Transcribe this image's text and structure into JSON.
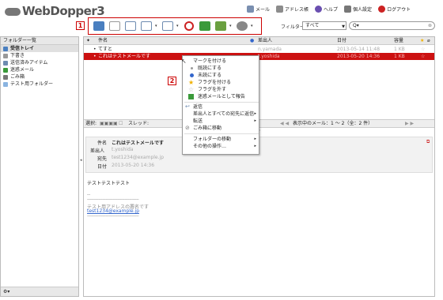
{
  "app": {
    "logo": "WebDopper3"
  },
  "topnav": [
    {
      "label": "メール",
      "icon": "mail-icon",
      "color": "#7a8fb0"
    },
    {
      "label": "アドレス帳",
      "icon": "address-book-icon",
      "color": "#8c8c8c"
    },
    {
      "label": "ヘルプ",
      "icon": "help-icon",
      "color": "#6a4fb0"
    },
    {
      "label": "個人設定",
      "icon": "personal-settings-icon",
      "color": "#777777"
    },
    {
      "label": "ログアウト",
      "icon": "logout-icon",
      "color": "#cc2222"
    }
  ],
  "callouts": {
    "toolbar": "1",
    "menu": "2"
  },
  "toolbar": {
    "buttons": [
      {
        "name": "check-mail-button",
        "icon": "check-mail-icon",
        "color": "#4a7fc0",
        "caret": false
      },
      {
        "name": "compose-button",
        "icon": "compose-icon",
        "color": "#9a9a9a",
        "caret": false
      },
      {
        "name": "reply-button",
        "icon": "reply-icon",
        "color": "#6d8bb0",
        "caret": false
      },
      {
        "name": "reply-all-button",
        "icon": "reply-all-icon",
        "color": "#6d8bb0",
        "caret": true
      },
      {
        "name": "forward-button",
        "icon": "forward-icon",
        "color": "#6d8bb0",
        "caret": true
      },
      {
        "name": "delete-button",
        "icon": "delete-icon",
        "color": "#cc2222",
        "caret": false
      },
      {
        "name": "print-button",
        "icon": "print-icon",
        "color": "#3a9a3a",
        "caret": false
      },
      {
        "name": "mark-button",
        "icon": "mark-icon",
        "color": "#6aa040",
        "caret": true
      },
      {
        "name": "more-button",
        "icon": "gear-icon",
        "color": "#888888",
        "caret": true
      }
    ]
  },
  "filter": {
    "label": "フィルター:",
    "value": "すべて",
    "search_placeholder": "Q▾"
  },
  "sidebar": {
    "title": "フォルダー一覧",
    "items": [
      {
        "label": "受信トレイ",
        "icon": "inbox-icon",
        "color": "#4a7fc0",
        "selected": true
      },
      {
        "label": "下書き",
        "icon": "drafts-icon",
        "color": "#999999",
        "selected": false
      },
      {
        "label": "送信済みアイテム",
        "icon": "sent-icon",
        "color": "#6d8bb0",
        "selected": false
      },
      {
        "label": "迷惑メール",
        "icon": "junk-icon",
        "color": "#3a9a3a",
        "selected": false
      },
      {
        "label": "ごみ箱",
        "icon": "trash-icon",
        "color": "#777777",
        "selected": false
      },
      {
        "label": "テスト用フォルダー",
        "icon": "folder-icon",
        "color": "#8ab4e0",
        "selected": false
      }
    ],
    "footer": "⚙▾"
  },
  "list": {
    "headers": {
      "subject": "件名",
      "from": "差出人",
      "date": "日付",
      "size": "容量"
    },
    "rows": [
      {
        "subject": "てすと",
        "from": "n.yamada",
        "date": "2013-05-14 11:48",
        "size": "1 KB",
        "selected": false
      },
      {
        "subject": "これはテストメールです",
        "from": "t.yoshida",
        "date": "2013-05-20 14:36",
        "size": "1 KB",
        "selected": true
      }
    ]
  },
  "pager": {
    "select_label": "選択:",
    "thread_label": "スレッド:",
    "status": "表示中のメール：1 ～ 2（全：2 件）"
  },
  "preview": {
    "subject_label": "件名",
    "subject": "これはテストメールです",
    "from_label": "差出人",
    "from": "t.yoshida",
    "to_label": "宛先",
    "to": "test1234@example.jp",
    "date_label": "日付",
    "date": "2013-05-20 14:36",
    "body_line1": "テストテストテスト",
    "sig_dash": "--",
    "sig_rule": "--------------------------------------------------",
    "sig_name": "テスト用アドレスの署名です",
    "sig_mail": "test1234@example.jp",
    "sig_rule2": "--------------------------------------------------"
  },
  "context_menu": [
    {
      "label": "マークを付ける",
      "icon": "",
      "color": "",
      "submenu": false
    },
    {
      "label": "既読にする",
      "icon": "read-dot-icon",
      "color": "#999999",
      "submenu": false
    },
    {
      "label": "未読にする",
      "icon": "unread-dot-icon",
      "color": "#3366cc",
      "submenu": false
    },
    {
      "label": "フラグを付ける",
      "icon": "star-icon",
      "color": "#f0b000",
      "submenu": false
    },
    {
      "label": "フラグを外す",
      "icon": "star-outline-icon",
      "color": "#bbbbbb",
      "submenu": false
    },
    {
      "label": "迷惑メールとして報告",
      "icon": "junk-report-icon",
      "color": "#3a9a3a",
      "submenu": false
    },
    {
      "label": "返信",
      "icon": "reply-icon",
      "color": "#6d8bb0",
      "submenu": false
    },
    {
      "label": "差出人とすべての宛先に返信",
      "icon": "",
      "color": "",
      "submenu": true
    },
    {
      "label": "転送",
      "icon": "",
      "color": "",
      "submenu": true
    },
    {
      "label": "ごみ箱に移動",
      "icon": "trash-move-icon",
      "color": "#777777",
      "submenu": false
    },
    {
      "label": "フォルダーの移動",
      "icon": "",
      "color": "",
      "submenu": true
    },
    {
      "label": "その他の操作…",
      "icon": "",
      "color": "",
      "submenu": true
    }
  ]
}
